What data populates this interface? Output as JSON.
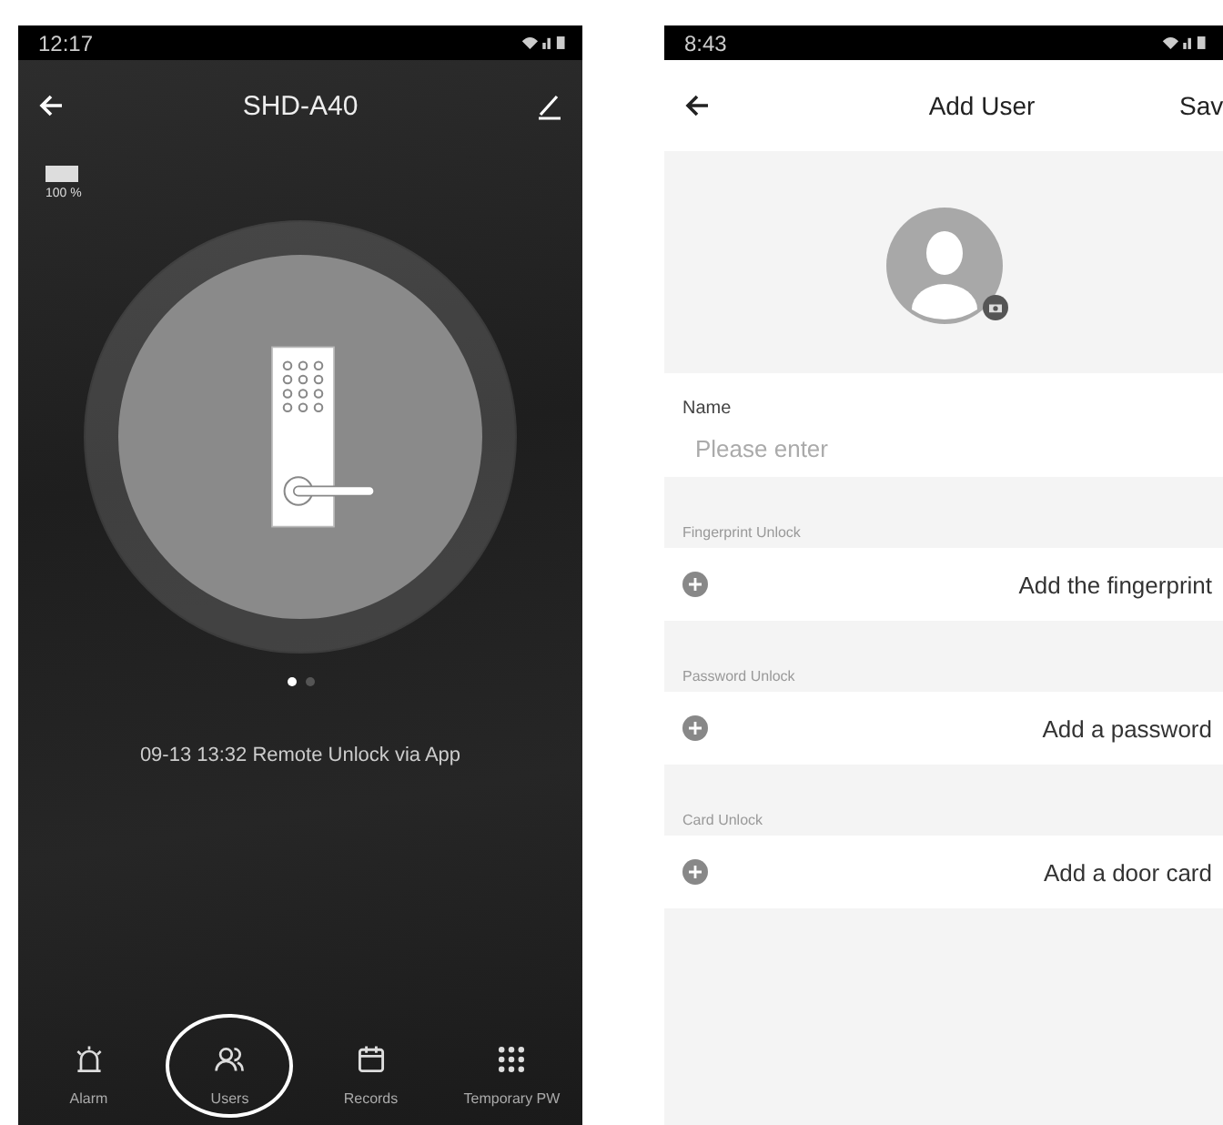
{
  "lock_screen": {
    "status_bar": {
      "time": "12:17"
    },
    "title": "SHD-A40",
    "battery": {
      "level": 1,
      "label": "100 %"
    },
    "page_dots": [
      {
        "selected": true
      },
      {
        "selected": false
      }
    ],
    "last_event": "09-13 13:32  Remote Unlock via App",
    "nav": [
      {
        "kind": "alarm",
        "label": "Alarm",
        "selected": false
      },
      {
        "kind": "users",
        "label": "Users",
        "selected": true
      },
      {
        "kind": "calendar",
        "label": "Records",
        "selected": false
      },
      {
        "kind": "keypad",
        "label": "Temporary PW",
        "selected": false
      }
    ]
  },
  "add_user_screen": {
    "status_bar": {
      "time": "8:43"
    },
    "title": "Add User",
    "save": "Sav",
    "name_field": {
      "label": "Name",
      "placeholder": "Please enter"
    },
    "sections": [
      {
        "heading": "Fingerprint Unlock",
        "action": "Add the fingerprint"
      },
      {
        "heading": "Password Unlock",
        "action": "Add a password"
      },
      {
        "heading": "Card Unlock",
        "action": "Add a door card"
      }
    ]
  }
}
